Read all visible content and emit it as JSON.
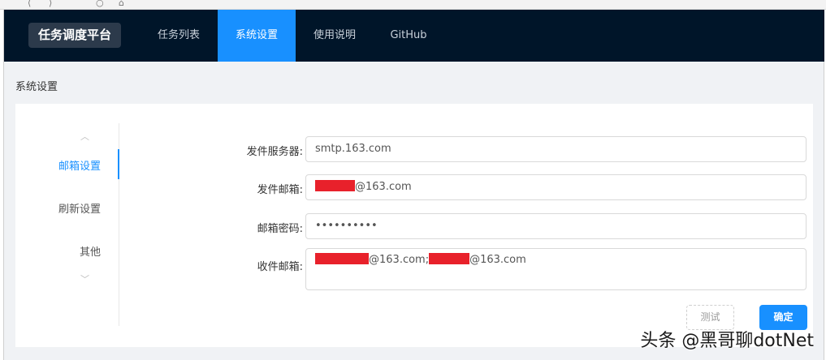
{
  "nav": {
    "brand": "任务调度平台",
    "items": [
      {
        "label": "任务列表",
        "active": false
      },
      {
        "label": "系统设置",
        "active": true
      },
      {
        "label": "使用说明",
        "active": false
      },
      {
        "label": "GitHub",
        "active": false
      }
    ]
  },
  "page": {
    "title": "系统设置"
  },
  "tabs": {
    "items": [
      {
        "label": "邮箱设置",
        "active": true
      },
      {
        "label": "刷新设置",
        "active": false
      },
      {
        "label": "其他",
        "active": false
      }
    ],
    "up_icon": "chevron-up-icon",
    "down_icon": "chevron-down-icon"
  },
  "form": {
    "smtp_label": "发件服务器:",
    "smtp_value": "smtp.163.com",
    "sender_label": "发件邮箱:",
    "sender_suffix": "@163.com",
    "password_label": "邮箱密码:",
    "password_value": "••••••••••",
    "receiver_label": "收件邮箱:",
    "receiver_suffix_1": "@163.com;",
    "receiver_suffix_2": "@163.com"
  },
  "buttons": {
    "test": "测试",
    "ok": "确定"
  },
  "watermark": "头条 @黑哥聊dotNet",
  "colors": {
    "nav_bg": "#001529",
    "accent": "#1890ff",
    "redaction": "#e8212b"
  }
}
